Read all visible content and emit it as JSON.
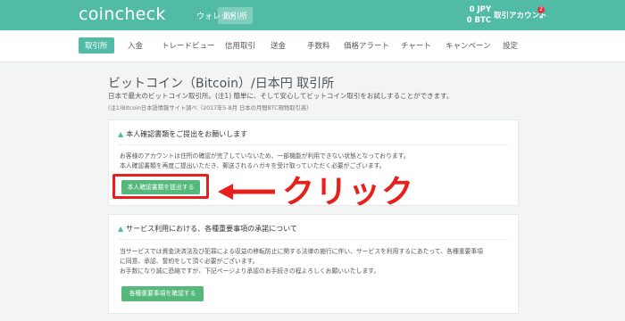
{
  "header": {
    "logo": "coincheck",
    "nav": [
      {
        "label": "ウォレット"
      },
      {
        "label": "取引所"
      }
    ],
    "balance": {
      "jpy": "0  JPY",
      "btc": "0  BTC"
    },
    "account": "取引アカウント",
    "notification_count": "2",
    "caret": "▾"
  },
  "subnav": {
    "items": [
      {
        "label": "取引所"
      },
      {
        "label": "入金"
      },
      {
        "label": "トレードビュー"
      },
      {
        "label": "信用取引"
      },
      {
        "label": "送金"
      },
      {
        "label": "手数料"
      },
      {
        "label": "価格アラート"
      },
      {
        "label": "チャート"
      },
      {
        "label": "キャンペーン"
      },
      {
        "label": "設定"
      }
    ],
    "active_index": 0
  },
  "page": {
    "title": "ビットコイン（Bitcoin）/日本円 取引所",
    "description": "日本で最大のビットコイン取引所。(注1) 簡単に、そして安心してビットコイン取引をお試しすることができます。",
    "note": "(注1)Bitcoin日本語情報サイト調べ（2017年5-8月 日本の月間BTC現物取引高）"
  },
  "cards": [
    {
      "title": "本人確認書類をご提出をお願いします",
      "lines": [
        "お客様のアカウントは住所の確認が完了していないため、一部機能が利用できない状態となっております。",
        "本人確認書類を再度ご提出いただき、郵送されるハガキを受け取っていただく必要がございます。"
      ],
      "button": "本人確認書類を提出する"
    },
    {
      "title": "サービス利用における、各種重要事項の承諾について",
      "lines": [
        "当サービスでは資金決済法及び犯罪による収益の移転防止に関する法律の施行に伴い、サービスを利用するにあたって、各種重要事項",
        "に同意、承認、誓約をして頂く必要がございます。",
        "お手数になり誠に恐縮ですが、下記ページより承認のお手続きの程よろしくお願いいたします。"
      ],
      "button": "各種重要事項を確認する"
    }
  ],
  "annotation": {
    "label": "クリック",
    "color": "#e8201c"
  },
  "colors": {
    "brand": "#52bba5",
    "button": "#57b87c"
  }
}
